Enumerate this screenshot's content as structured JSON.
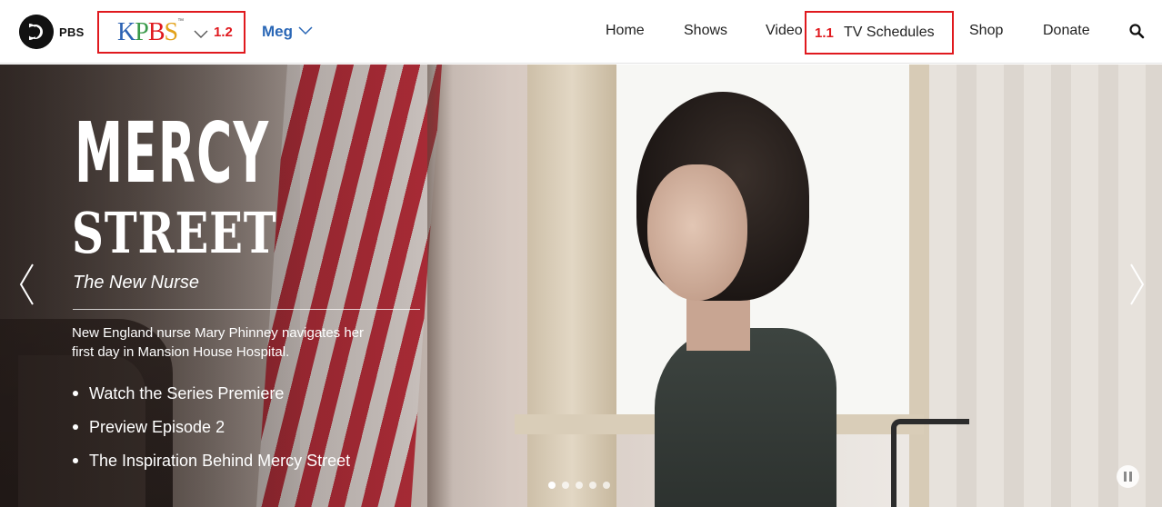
{
  "header": {
    "pbs_logo_text": "PBS",
    "station": {
      "logo_text": [
        "K",
        "P",
        "B",
        "S"
      ],
      "trademark": "™",
      "annotation": "1.2",
      "box_color": "#e0191e"
    },
    "user_menu": {
      "label": "Meg"
    },
    "nav": [
      {
        "label": "Home"
      },
      {
        "label": "Shows"
      },
      {
        "label": "Video"
      },
      {
        "label": "TV Schedules",
        "annotation": "1.1"
      },
      {
        "label": "Shop"
      },
      {
        "label": "Donate"
      }
    ],
    "search_icon": "search-icon"
  },
  "hero": {
    "title_line1": "MERCY",
    "title_line2": "STREET",
    "subtitle": "The New Nurse",
    "description": "New England nurse Mary Phinney navigates her first day in Mansion House Hospital.",
    "links": [
      {
        "label": "Watch the Series Premiere"
      },
      {
        "label": "Preview Episode 2"
      },
      {
        "label": "The Inspiration Behind Mercy Street"
      }
    ],
    "carousel": {
      "slide_count": 5,
      "active_slide": 1
    },
    "prev_icon": "chevron-left-icon",
    "next_icon": "chevron-right-icon",
    "pause_icon": "pause-icon"
  },
  "colors": {
    "accent_blue": "#2a67b6",
    "annotation_red": "#e0191e"
  }
}
